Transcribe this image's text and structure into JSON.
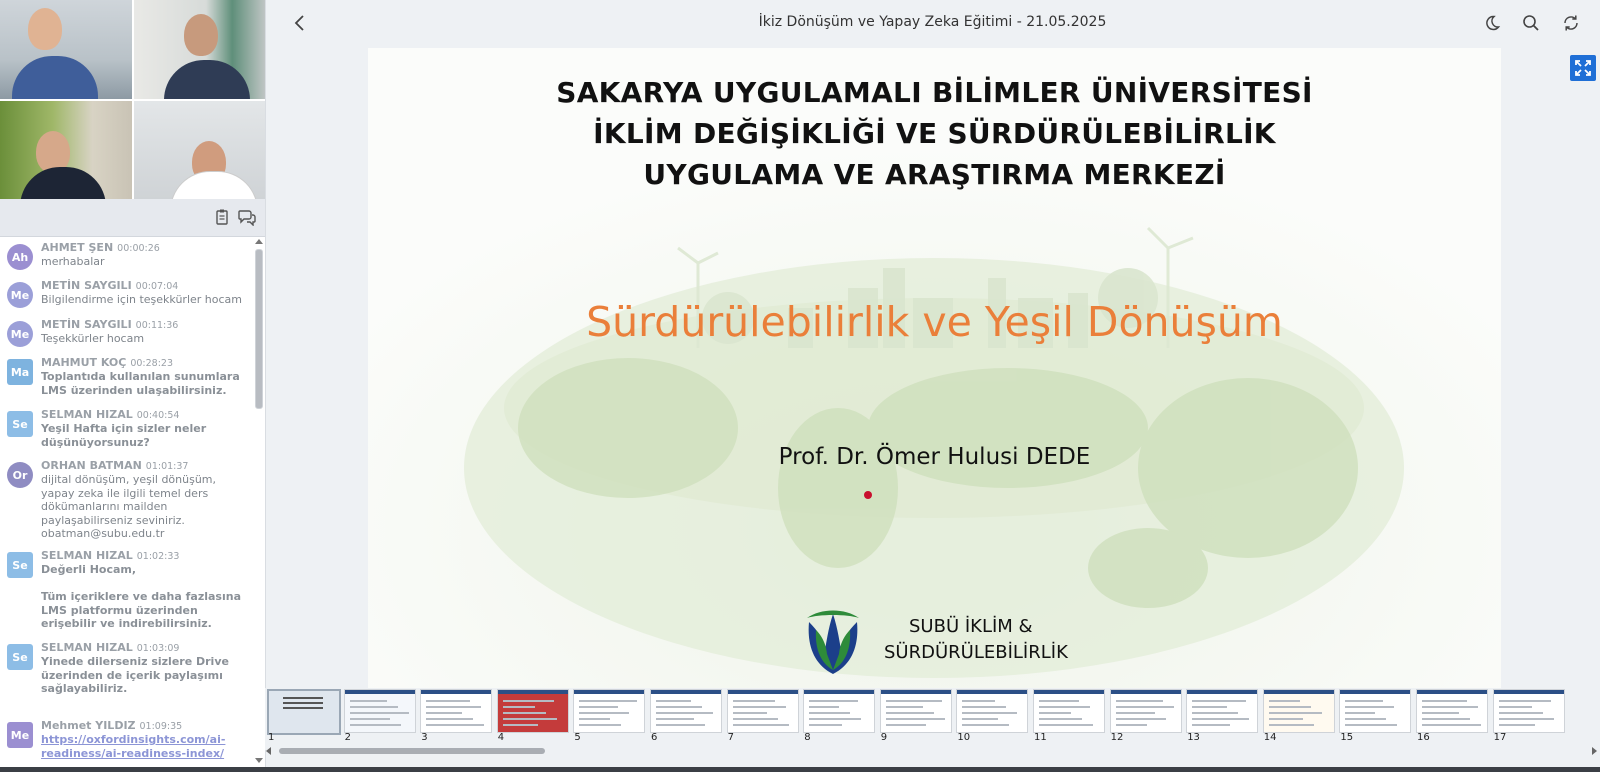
{
  "window": {
    "title": "İkiz Dönüşüm ve Yapay Zeka Eğitimi - 21.05.2025"
  },
  "icons": {
    "back": "chevron-left-icon",
    "theme": "moon-icon",
    "search": "search-icon",
    "refresh": "refresh-icon",
    "fullscreen": "fullscreen-icon",
    "copy": "clipboard-icon",
    "chat": "chat-bubbles-icon"
  },
  "colors": {
    "accent": "#1f6fd6",
    "slide_title": "#ea7f3a",
    "dot": "#c8102e"
  },
  "chat": {
    "messages": [
      {
        "initials": "Ah",
        "name": "AHMET ŞEN",
        "time": "00:00:26",
        "text": "merhabalar",
        "color": "#9b8fd1",
        "bold": false
      },
      {
        "initials": "Me",
        "name": "METİN SAYGILI",
        "time": "00:07:04",
        "text": "Bilgilendirme için teşekkürler hocam",
        "color": "#9b9fd8",
        "bold": false
      },
      {
        "initials": "Me",
        "name": "METİN SAYGILI",
        "time": "00:11:36",
        "text": "Teşekkürler hocam",
        "color": "#9b9fd8",
        "bold": false
      },
      {
        "initials": "Ma",
        "name": "MAHMUT KOÇ",
        "time": "00:28:23",
        "text": "Toplantıda kullanılan sunumlara LMS üzerinden ulaşabilirsiniz.",
        "color": "#7eb3df",
        "bold": true
      },
      {
        "initials": "Se",
        "name": "SELMAN HIZAL",
        "time": "00:40:54",
        "text": "Yeşil Hafta için sizler neler düşünüyorsunuz?",
        "color": "#8dbde6",
        "bold": true
      },
      {
        "initials": "Or",
        "name": "ORHAN BATMAN",
        "time": "01:01:37",
        "text": "dijital dönüşüm, yeşil dönüşüm, yapay zeka ile ilgili temel ders dökümanlarını mailden paylaşabilirseniz seviniriz. obatman@subu.edu.tr",
        "color": "#8f8cc2",
        "bold": false
      },
      {
        "initials": "Se",
        "name": "SELMAN HIZAL",
        "time": "01:02:33",
        "text": "Değerli Hocam,\n\nTüm içeriklere ve daha fazlasına LMS platformu üzerinden erişebilir ve indirebilirsiniz.",
        "color": "#8dbde6",
        "bold": true
      },
      {
        "initials": "Se",
        "name": "SELMAN HIZAL",
        "time": "01:03:09",
        "text": "Yinede dilerseniz sizlere Drive üzerinden de içerik paylaşımı sağlayabiliriz.",
        "color": "#8dbde6",
        "bold": true
      },
      {
        "initials": "Me",
        "name": "Mehmet YILDIZ",
        "time": "01:09:35",
        "text": "https://oxfordinsights.com/ai-readiness/ai-readiness-index/",
        "color": "#9b8fd1",
        "bold": false,
        "link": true
      }
    ]
  },
  "slide": {
    "heading": [
      "SAKARYA UYGULAMALI BİLİMLER ÜNİVERSİTESİ",
      "İKLİM DEĞİŞİKLİĞİ VE SÜRDÜRÜLEBİLİRLİK",
      "UYGULAMA VE ARAŞTIRMA MERKEZİ"
    ],
    "title": "Sürdürülebilirlik ve Yeşil Dönüşüm",
    "author": "Prof. Dr. Ömer Hulusi DEDE",
    "logo_text": [
      "SUBÜ İKLİM &",
      "SÜRDÜRÜLEBİLİRLİK"
    ]
  },
  "thumbnails": [
    "1",
    "2",
    "3",
    "4",
    "5",
    "6",
    "7",
    "8",
    "9",
    "10",
    "11",
    "12",
    "13",
    "14",
    "15",
    "16",
    "17"
  ]
}
